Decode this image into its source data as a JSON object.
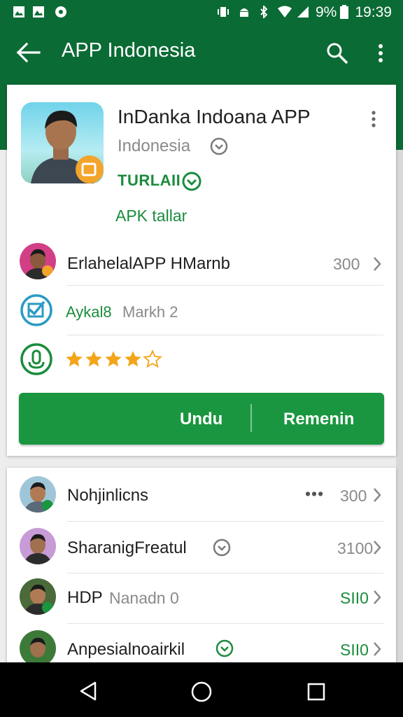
{
  "status_bar": {
    "battery_text": "9%",
    "time": "19:39"
  },
  "app_bar": {
    "title": "APP Indonesia"
  },
  "app_card": {
    "name": "InDanka Indoana APP",
    "developer": "Indonesia",
    "tag": "TURLAII",
    "subtitle": "APK tallar",
    "rows": [
      {
        "label": "ErlahelalAPP HMarnb",
        "value": "300"
      },
      {
        "label_accent": "Aykal8",
        "label": "Markh 2"
      },
      {
        "rating_stars": 4,
        "rating_max": 5
      }
    ],
    "buttons": {
      "primary": "Undu",
      "secondary": "Remenin"
    }
  },
  "list": [
    {
      "label": "Nohjinlicns",
      "prefix": "•••",
      "value": "300"
    },
    {
      "label": "SharanigFreatul",
      "value": "3100"
    },
    {
      "label": "HDP",
      "label_muted": "Nanadn 0",
      "value": "SII0"
    },
    {
      "label": "Anpesialnoairkil",
      "value": "SII0"
    }
  ],
  "colors": {
    "primary_dark": "#0b6b35",
    "primary": "#1a9640",
    "accent_text": "#1a8c3c",
    "star": "#f2a51a"
  },
  "icons": [
    "back-arrow-icon",
    "search-icon",
    "more-vert-icon",
    "chevron-right-icon",
    "check-circle-icon",
    "download-icon",
    "star-icon",
    "nav-back-icon",
    "nav-home-icon",
    "nav-recents-icon"
  ]
}
